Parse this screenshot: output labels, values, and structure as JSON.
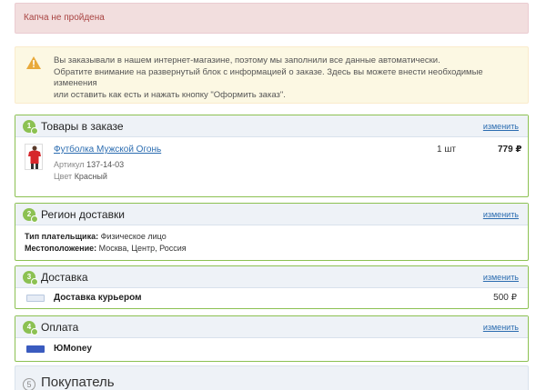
{
  "alerts": {
    "error": "Капча не пройдена",
    "warning_lines": [
      "Вы заказывали в нашем интернет-магазине, поэтому мы заполнили все данные автоматически.",
      "Обратите внимание на развернутый блок с информацией о заказе. Здесь вы можете внести необходимые изменения",
      "или оставить как есть и нажать кнопку \"Оформить заказ\"."
    ]
  },
  "edit_label": "изменить",
  "goods": {
    "step": "1",
    "title": "Товары в заказе",
    "item": {
      "name": "Футболка Мужской Огонь",
      "qty": "1 шт",
      "price": "779 ₽",
      "article_label": "Артикул",
      "article_value": "137-14-03",
      "color_label": "Цвет",
      "color_value": "Красный"
    }
  },
  "region": {
    "step": "2",
    "title": "Регион доставки",
    "payer_label": "Тип плательщика:",
    "payer_value": "Физическое лицо",
    "location_label": "Местоположение:",
    "location_value": "Москва, Центр, Россия"
  },
  "delivery": {
    "step": "3",
    "title": "Доставка",
    "service": "Доставка курьером",
    "price": "500 ₽"
  },
  "payment": {
    "step": "4",
    "title": "Оплата",
    "service": "ЮMoney"
  },
  "buyer": {
    "step": "5",
    "title": "Покупатель"
  },
  "colors": {
    "accent_green": "#8cc152",
    "link_blue": "#2b6cb0",
    "error_bg": "#f2dede",
    "warning_bg": "#fcf8e3"
  }
}
